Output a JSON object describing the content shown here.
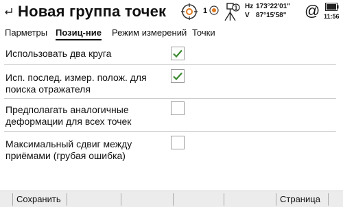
{
  "header": {
    "title": "Новая группа точек",
    "prism_count": "1",
    "hz_label": "Hz",
    "hz_value": "173°22'01\"",
    "v_label": "V",
    "v_value": "87°15'58\"",
    "connection_symbol": "@",
    "time": "11:56",
    "icons": [
      "back-arrow-icon",
      "target-icon",
      "prism-icon",
      "instrument-icon",
      "at-icon",
      "battery-icon"
    ]
  },
  "tabs": [
    {
      "label": "Парметры",
      "active": false
    },
    {
      "label": "Позиц-ние",
      "active": true
    },
    {
      "label": "Режим измерений",
      "active": false
    },
    {
      "label": "Точки",
      "active": false
    }
  ],
  "options": [
    {
      "line1": "Использовать два круга",
      "line2": "",
      "checked": true
    },
    {
      "line1": "Исп. послед. измер. полож. для",
      "line2": "поиска отражателя",
      "checked": true
    },
    {
      "line1": "Предполагать аналогичные",
      "line2": "деформации для всех точек",
      "checked": false
    },
    {
      "line1": "Максимальный сдвиг между",
      "line2": "приёмами (грубая ошибка)",
      "checked": false
    }
  ],
  "softkeys": {
    "save": "Сохранить",
    "page": "Страница"
  },
  "colors": {
    "check": "#3a8a2e",
    "checkbox_border": "#9a9a9a",
    "bottombar": "#ececec",
    "divider": "#c8c8c8"
  }
}
